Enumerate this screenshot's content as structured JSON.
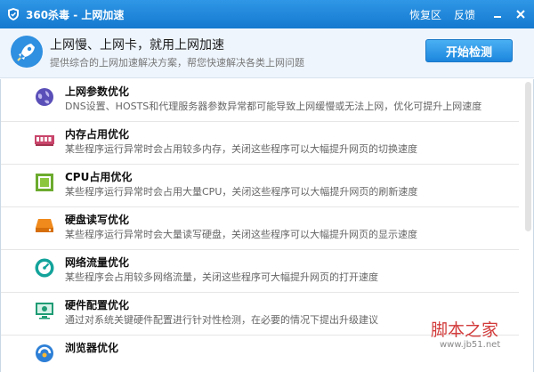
{
  "titlebar": {
    "title": "360杀毒 - 上网加速",
    "restore_label": "恢复区",
    "feedback_label": "反馈",
    "logo_icon": "shield-icon",
    "accent": "#1a83d9"
  },
  "banner": {
    "headline": "上网慢、上网卡，就用上网加速",
    "subline": "提供综合的上网加速解决方案，帮您快速解决各类上网问题",
    "start_button": "开始检测",
    "icon": "rocket-icon"
  },
  "items": [
    {
      "name": "上网参数优化",
      "desc": "DNS设置、HOSTS和代理服务器参数异常都可能导致上网缓慢或无法上网，优化可提升上网速度",
      "icon": "globe-icon"
    },
    {
      "name": "内存占用优化",
      "desc": "某些程序运行异常时会占用较多内存，关闭这些程序可以大幅提升网页的切换速度",
      "icon": "memory-icon"
    },
    {
      "name": "CPU占用优化",
      "desc": "某些程序运行异常时会占用大量CPU，关闭这些程序可以大幅提升网页的刷新速度",
      "icon": "cpu-icon"
    },
    {
      "name": "硬盘读写优化",
      "desc": "某些程序运行异常时会大量读写硬盘，关闭这些程序可以大幅提升网页的显示速度",
      "icon": "harddisk-icon"
    },
    {
      "name": "网络流量优化",
      "desc": "某些程序会占用较多网络流量，关闭这些程序可大幅提升网页的打开速度",
      "icon": "speedometer-icon"
    },
    {
      "name": "硬件配置优化",
      "desc": "通过对系统关键硬件配置进行针对性检测，在必要的情况下提出升级建议",
      "icon": "monitor-icon"
    },
    {
      "name": "浏览器优化",
      "desc": "",
      "icon": "browser-icon"
    }
  ],
  "watermark": {
    "text": "脚本之家",
    "url": "www.jb51.net"
  }
}
